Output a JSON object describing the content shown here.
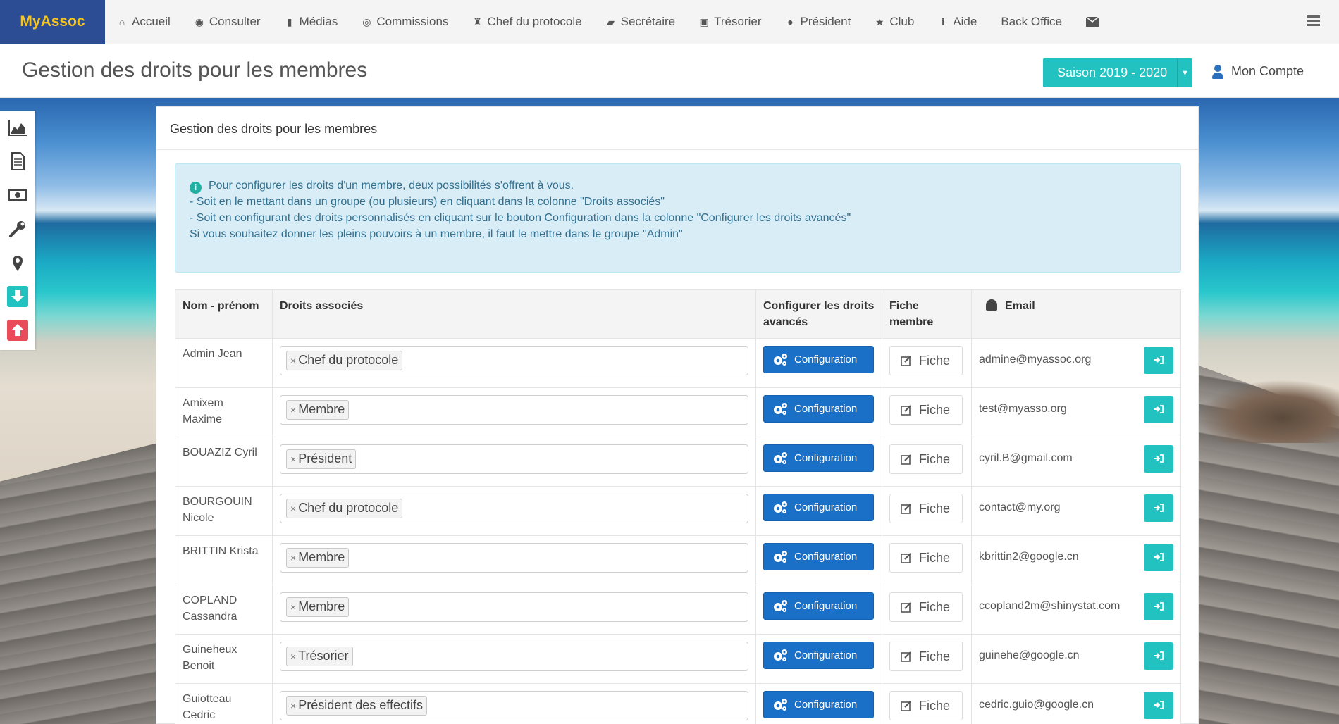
{
  "brand": "MyAssoc",
  "nav": [
    {
      "label": "Accueil",
      "icon": "home-icon"
    },
    {
      "label": "Consulter",
      "icon": "eye-icon"
    },
    {
      "label": "Médias",
      "icon": "file-icon"
    },
    {
      "label": "Commissions",
      "icon": "users-circle-icon"
    },
    {
      "label": "Chef du protocole",
      "icon": "trophy-icon"
    },
    {
      "label": "Secrétaire",
      "icon": "book-icon"
    },
    {
      "label": "Trésorier",
      "icon": "money-icon"
    },
    {
      "label": "Président",
      "icon": "globe-icon"
    },
    {
      "label": "Club",
      "icon": "star-icon"
    },
    {
      "label": "Aide",
      "icon": "info-icon"
    },
    {
      "label": "Back Office",
      "icon": ""
    }
  ],
  "header": {
    "title": "Gestion des droits pour les membres",
    "season": "Saison 2019 - 2020",
    "account": "Mon Compte"
  },
  "panel": {
    "title": "Gestion des droits pour les membres",
    "alert_lines": [
      "Pour configurer les droits d'un membre, deux possibilités s'offrent à vous.",
      "- Soit en le mettant dans un groupe (ou plusieurs) en cliquant dans la colonne \"Droits associés\"",
      "- Soit en configurant des droits personnalisés en cliquant sur le bouton Configuration dans la colonne \"Configurer les droits avancés\"",
      "",
      "Si vous souhaitez donner les pleins pouvoirs à un membre, il faut le mettre dans le groupe \"Admin\""
    ]
  },
  "table": {
    "headers": {
      "name": "Nom - prénom",
      "rights": "Droits associés",
      "advanced": "Configurer les droits avancés",
      "fiche": "Fiche membre",
      "email": "Email"
    },
    "config_label": "Configuration",
    "fiche_label": "Fiche",
    "rows": [
      {
        "name": "Admin Jean",
        "group": "Chef du protocole",
        "email": "admine@myassoc.org"
      },
      {
        "name": "Amixem Maxime",
        "group": "Membre",
        "email": "test@myasso.org"
      },
      {
        "name": "BOUAZIZ Cyril",
        "group": "Président",
        "email": "cyril.B@gmail.com"
      },
      {
        "name": "BOURGOUIN Nicole",
        "group": "Chef du protocole",
        "email": "contact@my.org"
      },
      {
        "name": "BRITTIN Krista",
        "group": "Membre",
        "email": "kbrittin2@google.cn"
      },
      {
        "name": "COPLAND Cassandra",
        "group": "Membre",
        "email": "ccopland2m@shinystat.com"
      },
      {
        "name": "Guineheux Benoit",
        "group": "Trésorier",
        "email": "guinehe@google.cn"
      },
      {
        "name": "Guiotteau Cedric",
        "group": "Président des effectifs",
        "email": "cedric.guio@google.cn"
      }
    ]
  },
  "colors": {
    "brand_bg": "#2c4d94",
    "brand_text": "#f7c51e",
    "teal": "#21c2c0",
    "primary": "#1a6fc7",
    "alert_bg": "#d9edf7",
    "sidebar_down": "#21c2c0",
    "sidebar_up": "#e94b5b"
  }
}
